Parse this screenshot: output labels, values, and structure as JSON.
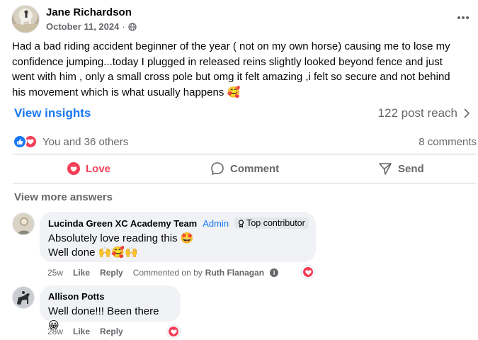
{
  "post": {
    "author": "Jane Richardson",
    "date": "October 11, 2024",
    "meta_separator": "·",
    "audience_icon": "globe-icon",
    "text": "Had a bad riding accident beginner of the year ( not on my own horse) causing me to lose my confidence jumping...today I plugged in released reins slightly looked beyond fence and just went with him , only a small  cross pole but omg it felt amazing ,i felt so secure and not behind his movement which is what usually happens 🥰"
  },
  "insights": {
    "link_label": "View insights",
    "reach_label": "122 post reach"
  },
  "reactions": {
    "types": [
      "like",
      "love"
    ],
    "summary": "You and 36 others",
    "comments_count": "8 comments"
  },
  "actions": {
    "love": "Love",
    "comment": "Comment",
    "send": "Send"
  },
  "comments_section": {
    "view_more": "View more answers",
    "comments": [
      {
        "author": "Lucinda Green XC Academy Team",
        "admin_badge": "Admin",
        "contributor_badge": "Top contributor",
        "line1": "Absolutely love reading this 🤩",
        "line2": "Well done 🙌🥰🙌",
        "age": "25w",
        "like": "Like",
        "reply": "Reply",
        "commented_on_prefix": "Commented on by",
        "commented_on_name": "Ruth Flanagan",
        "reaction": "love"
      },
      {
        "author": "Allison Potts",
        "line1": "Well done!!! Been there 😀",
        "age": "28w",
        "like": "Like",
        "reply": "Reply",
        "reaction": "love"
      }
    ]
  },
  "colors": {
    "accent_blue": "#1877f2",
    "love_red": "#f33e58",
    "secondary_text": "#65676b",
    "bubble_bg": "#f0f2f5"
  }
}
